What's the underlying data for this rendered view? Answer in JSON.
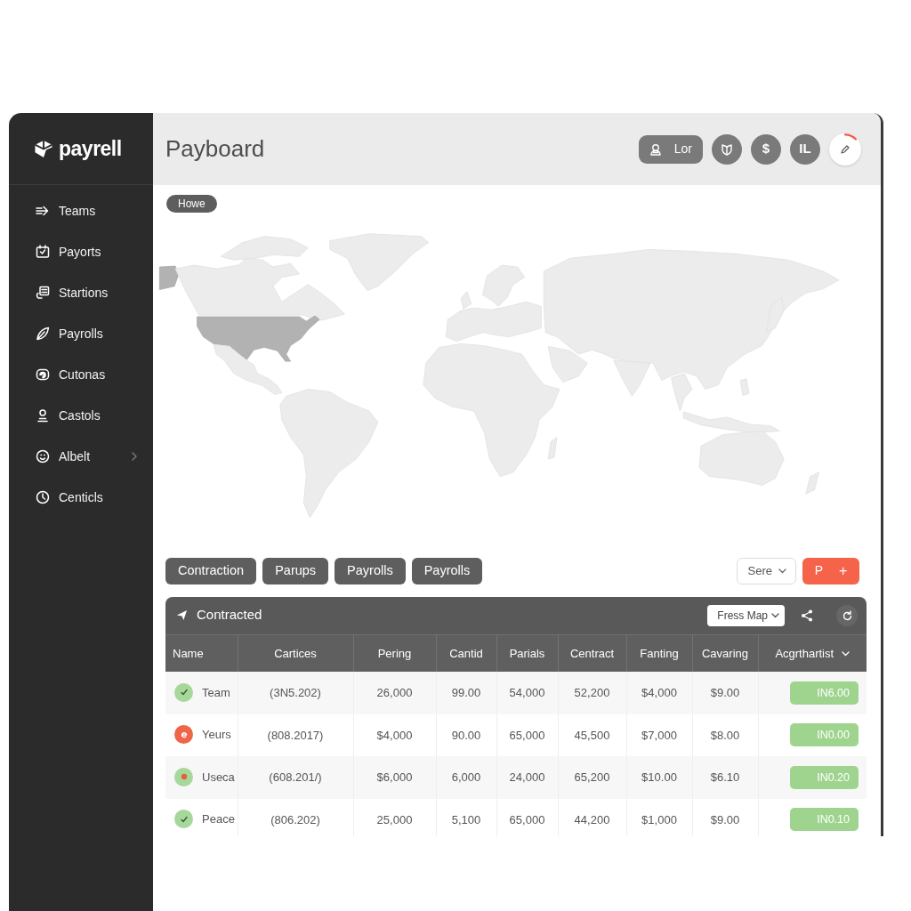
{
  "brand": {
    "name": "payrell"
  },
  "sidebar": {
    "items": [
      {
        "label": "Teams",
        "has_submenu": false
      },
      {
        "label": "Payorts",
        "has_submenu": false
      },
      {
        "label": "Startions",
        "has_submenu": false
      },
      {
        "label": "Payrolls",
        "has_submenu": false
      },
      {
        "label": "Cutonas",
        "has_submenu": false
      },
      {
        "label": "Castols",
        "has_submenu": false
      },
      {
        "label": "Albelt",
        "has_submenu": true
      },
      {
        "label": "Centicls",
        "has_submenu": false
      }
    ]
  },
  "header": {
    "title": "Payboard",
    "user_button": {
      "label": "Lor"
    },
    "currency_button": {
      "symbol": "$"
    },
    "avatar": {
      "initials": "IL"
    }
  },
  "breadcrumb": {
    "label": "Howe"
  },
  "filter_buttons": [
    "Contraction",
    "Parups",
    "Payrolls",
    "Payrolls"
  ],
  "sort_dropdown": {
    "label": "Sere"
  },
  "add_button": {
    "label": "P",
    "symbol": "+"
  },
  "table": {
    "title": "Contracted",
    "view_dropdown": {
      "label": "Fress Map"
    },
    "columns": [
      {
        "label": "Name",
        "has_menu": false
      },
      {
        "label": "Cartices",
        "has_menu": false
      },
      {
        "label": "Pering",
        "has_menu": false
      },
      {
        "label": "Cantid",
        "has_menu": false
      },
      {
        "label": "Parials",
        "has_menu": false
      },
      {
        "label": "Centract",
        "has_menu": false
      },
      {
        "label": "Fanting",
        "has_menu": false
      },
      {
        "label": "Cavaring",
        "has_menu": false
      },
      {
        "label": "Acgrthartist",
        "has_menu": true
      }
    ],
    "rows": [
      {
        "status": {
          "kind": "check",
          "color": "#a6d89c"
        },
        "name": "Team",
        "values": [
          "(3N5.202)",
          "26,000",
          "99.00",
          "54,000",
          "52,200",
          "$4,000",
          "$9.00"
        ],
        "amount": "IN6.00"
      },
      {
        "status": {
          "kind": "alert",
          "color": "#ee6548"
        },
        "name": "Yeurs",
        "values": [
          "(808.2017)",
          "$4,000",
          "90.00",
          "65,000",
          "45,500",
          "$7,000",
          "$8.00"
        ],
        "amount": "IN0.00"
      },
      {
        "status": {
          "kind": "dot",
          "color": "#a6d89c"
        },
        "name": "Useca",
        "values": [
          "(608.201/)",
          "$6,000",
          "6,000",
          "24,000",
          "65,200",
          "$10.00",
          "$6.10"
        ],
        "amount": "IN0.20"
      },
      {
        "status": {
          "kind": "check",
          "color": "#a6d89c"
        },
        "name": "Peace",
        "values": [
          "(806.202)",
          "25,000",
          "5,100",
          "65,000",
          "44,200",
          "$1,000",
          "$9.00"
        ],
        "amount": "IN0.10"
      }
    ]
  }
}
